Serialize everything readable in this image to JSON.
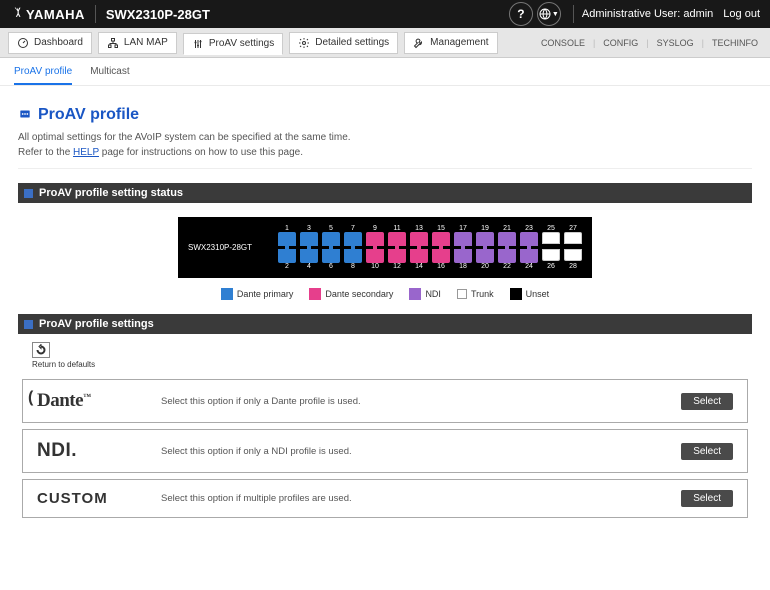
{
  "topbar": {
    "brand": "YAMAHA",
    "model": "SWX2310P-28GT",
    "help_icon": "?",
    "globe_icon": "globe",
    "user_label": "Administrative User: admin",
    "logout_label": "Log out"
  },
  "ribbon": {
    "tabs": [
      {
        "icon": "dashboard",
        "label": "Dashboard"
      },
      {
        "icon": "lanmap",
        "label": "LAN MAP"
      },
      {
        "icon": "proav",
        "label": "ProAV settings",
        "active": true
      },
      {
        "icon": "gear",
        "label": "Detailed settings"
      },
      {
        "icon": "wrench",
        "label": "Management"
      }
    ],
    "status": [
      "CONSOLE",
      "CONFIG",
      "SYSLOG",
      "TECHINFO"
    ]
  },
  "subtabs": {
    "active": "ProAV profile",
    "items": [
      "ProAV profile",
      "Multicast"
    ]
  },
  "page": {
    "title": "ProAV profile",
    "desc_prefix": "All optimal settings for the AVoIP system can be specified at the same time.",
    "desc_line2a": "Refer to the ",
    "help_link": "HELP",
    "desc_line2b": " page for instructions on how to use this page."
  },
  "panel_status": {
    "title": "ProAV profile setting status",
    "device": "SWX2310P-28GT",
    "top_nums": [
      "1",
      "3",
      "5",
      "7",
      "9",
      "11",
      "13",
      "15",
      "17",
      "19",
      "21",
      "23",
      "25",
      "27"
    ],
    "bot_nums": [
      "2",
      "4",
      "6",
      "8",
      "10",
      "12",
      "14",
      "16",
      "18",
      "20",
      "22",
      "24",
      "26",
      "28"
    ],
    "top_ports": [
      "dante-primary",
      "dante-primary",
      "dante-primary",
      "dante-primary",
      "dante-secondary",
      "dante-secondary",
      "dante-secondary",
      "dante-secondary",
      "ndi",
      "ndi",
      "ndi",
      "ndi",
      "trunk",
      "trunk"
    ],
    "bot_ports": [
      "dante-primary",
      "dante-primary",
      "dante-primary",
      "dante-primary",
      "dante-secondary",
      "dante-secondary",
      "dante-secondary",
      "dante-secondary",
      "ndi",
      "ndi",
      "ndi",
      "ndi",
      "trunk",
      "trunk"
    ],
    "legend": [
      {
        "color": "#2f7fd2",
        "label": "Dante primary"
      },
      {
        "color": "#e63f8c",
        "label": "Dante secondary"
      },
      {
        "color": "#9966cc",
        "label": "NDI"
      },
      {
        "color": "trunk",
        "label": "Trunk"
      },
      {
        "color": "#000",
        "label": "Unset"
      }
    ]
  },
  "panel_settings": {
    "title": "ProAV profile settings",
    "reset_label": "Return to defaults",
    "select_label": "Select",
    "rows": [
      {
        "logo": "Dante",
        "desc": "Select this option if only a Dante profile is used."
      },
      {
        "logo": "NDI",
        "desc": "Select this option if only a NDI profile is used."
      },
      {
        "logo": "CUSTOM",
        "desc": "Select this option if multiple profiles are used."
      }
    ]
  }
}
